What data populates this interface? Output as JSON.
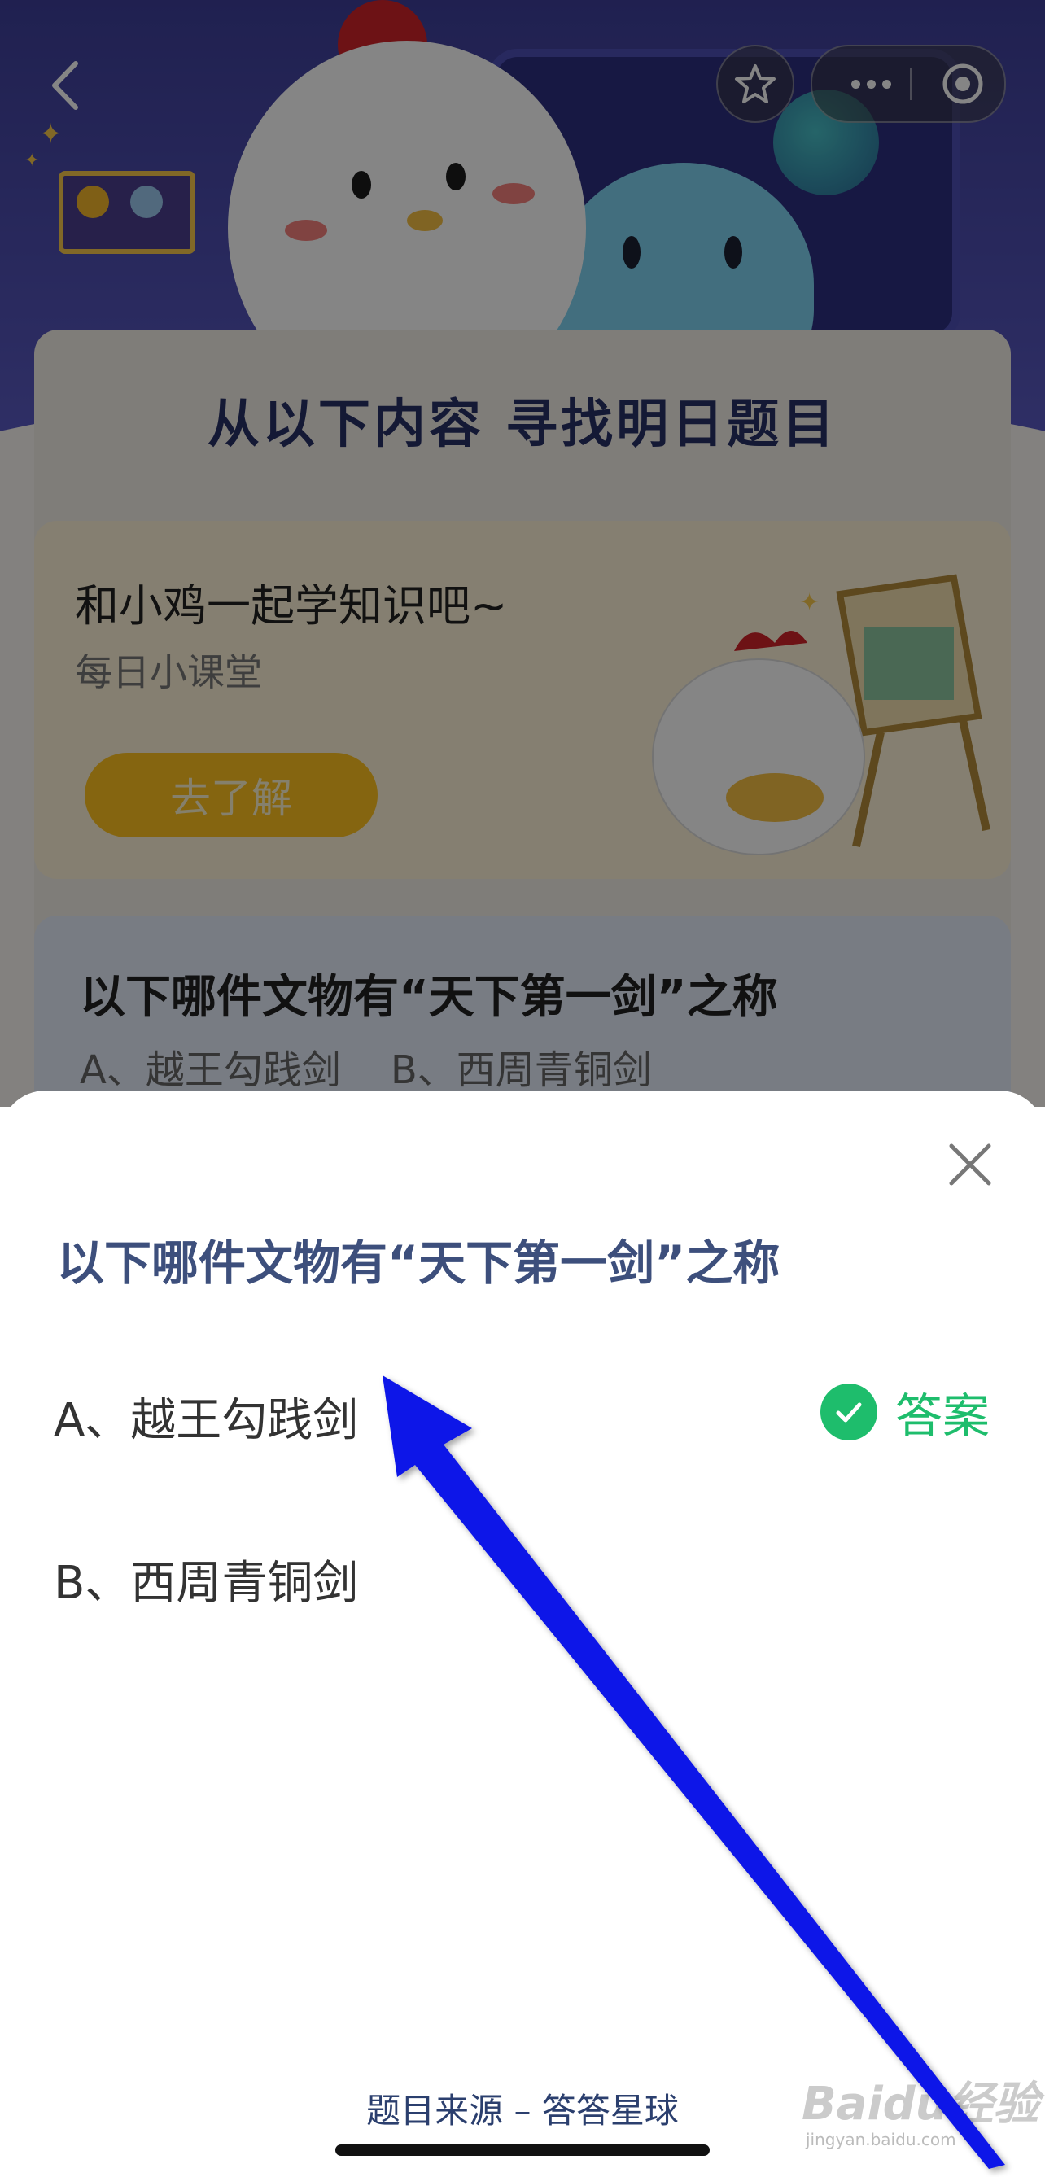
{
  "background": {
    "section_title": "从以下内容 寻找明日题目",
    "learn_card": {
      "title": "和小鸡一起学知识吧~",
      "subtitle": "每日小课堂",
      "button_label": "去了解"
    },
    "quiz_card": {
      "question": "以下哪件文物有“天下第一剑”之称",
      "options": "A、越王勾践剑    B、西周青铜剑"
    }
  },
  "nav": {
    "back_icon": "chevron-left-icon",
    "favorite_icon": "star-icon",
    "more_icon": "more-dots-icon",
    "close_icon": "target-circle-icon"
  },
  "sheet": {
    "question": "以下哪件文物有“天下第一剑”之称",
    "options": [
      {
        "label": "A、越王勾践剑",
        "is_answer": true
      },
      {
        "label": "B、西周青铜剑",
        "is_answer": false
      }
    ],
    "answer_label": "答案",
    "footer_source": "题目来源 – 答答星球"
  },
  "watermark": {
    "text": "Baidu经验",
    "sub": "jingyan.baidu.com"
  },
  "colors": {
    "accent_green": "#1ebd6c",
    "question_blue": "#3d4f7c",
    "annotation_arrow": "#0a14e8"
  }
}
